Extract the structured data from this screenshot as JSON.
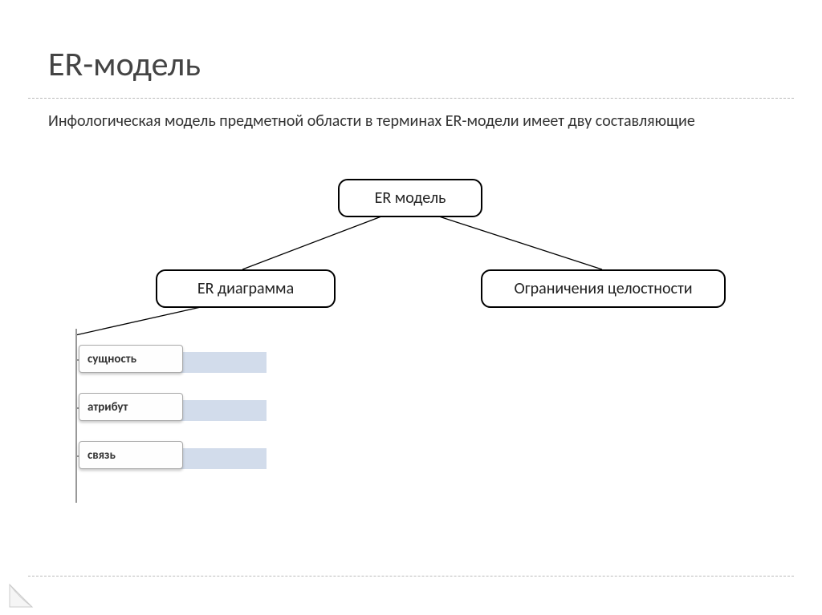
{
  "title": "ER-модель",
  "subtitle": "Инфологическая модель предметной области в терминах ER-модели имеет дву составляющие",
  "diagram": {
    "root": "ER модель",
    "left": "ER диаграмма",
    "right": "Ограничения целостности",
    "subitems": [
      "сущность",
      "атрибут",
      "связь"
    ]
  }
}
